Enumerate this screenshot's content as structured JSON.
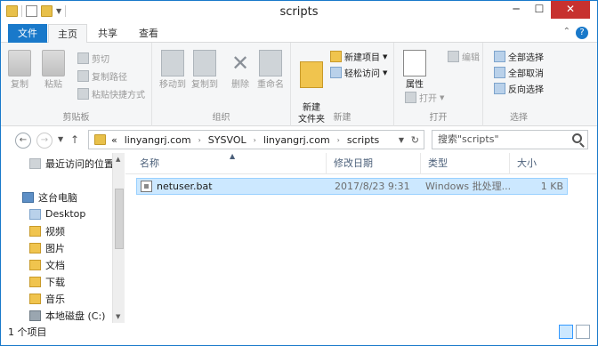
{
  "window": {
    "title": "scripts",
    "controls": {
      "minimize": "─",
      "maximize": "☐",
      "close": "✕"
    }
  },
  "ribbon_tabs": {
    "file": "文件",
    "home": "主页",
    "share": "共享",
    "view": "查看"
  },
  "ribbon": {
    "clipboard": {
      "label": "剪贴板",
      "copy": "复制",
      "paste": "粘贴",
      "cut": "剪切",
      "copy_path": "复制路径",
      "paste_shortcut": "粘贴快捷方式"
    },
    "organize": {
      "label": "组织",
      "move_to": "移动到",
      "copy_to": "复制到",
      "delete": "删除",
      "rename": "重命名"
    },
    "new": {
      "label": "新建",
      "new_folder": "新建\n文件夹",
      "new_item": "新建项目",
      "easy_access": "轻松访问"
    },
    "open": {
      "label": "打开",
      "properties": "属性",
      "open": "打开",
      "edit": "编辑"
    },
    "select": {
      "label": "选择",
      "select_all": "全部选择",
      "select_none": "全部取消",
      "invert": "反向选择"
    }
  },
  "address": {
    "path": [
      "«",
      "linyangrj.com",
      "SYSVOL",
      "linyangrj.com",
      "scripts"
    ],
    "search_placeholder": "搜索\"scripts\""
  },
  "nav_pane": {
    "items": [
      {
        "label": "最近访问的位置",
        "icon": "recent-icon"
      },
      {
        "label": "这台电脑",
        "icon": "computer-icon"
      },
      {
        "label": "Desktop",
        "icon": "folder-icon"
      },
      {
        "label": "视频",
        "icon": "folder-icon"
      },
      {
        "label": "图片",
        "icon": "folder-icon"
      },
      {
        "label": "文档",
        "icon": "folder-icon"
      },
      {
        "label": "下载",
        "icon": "folder-icon"
      },
      {
        "label": "音乐",
        "icon": "folder-icon"
      },
      {
        "label": "本地磁盘 (C:)",
        "icon": "drive-icon"
      }
    ]
  },
  "columns": {
    "name": "名称",
    "modified": "修改日期",
    "type": "类型",
    "size": "大小"
  },
  "files": [
    {
      "name": "netuser.bat",
      "modified": "2017/8/23 9:31",
      "type": "Windows 批处理...",
      "size": "1 KB"
    }
  ],
  "status": {
    "count": "1 个项目"
  },
  "colors": {
    "accent": "#1979ca",
    "close": "#c7312f",
    "selection": "#cce8ff"
  }
}
